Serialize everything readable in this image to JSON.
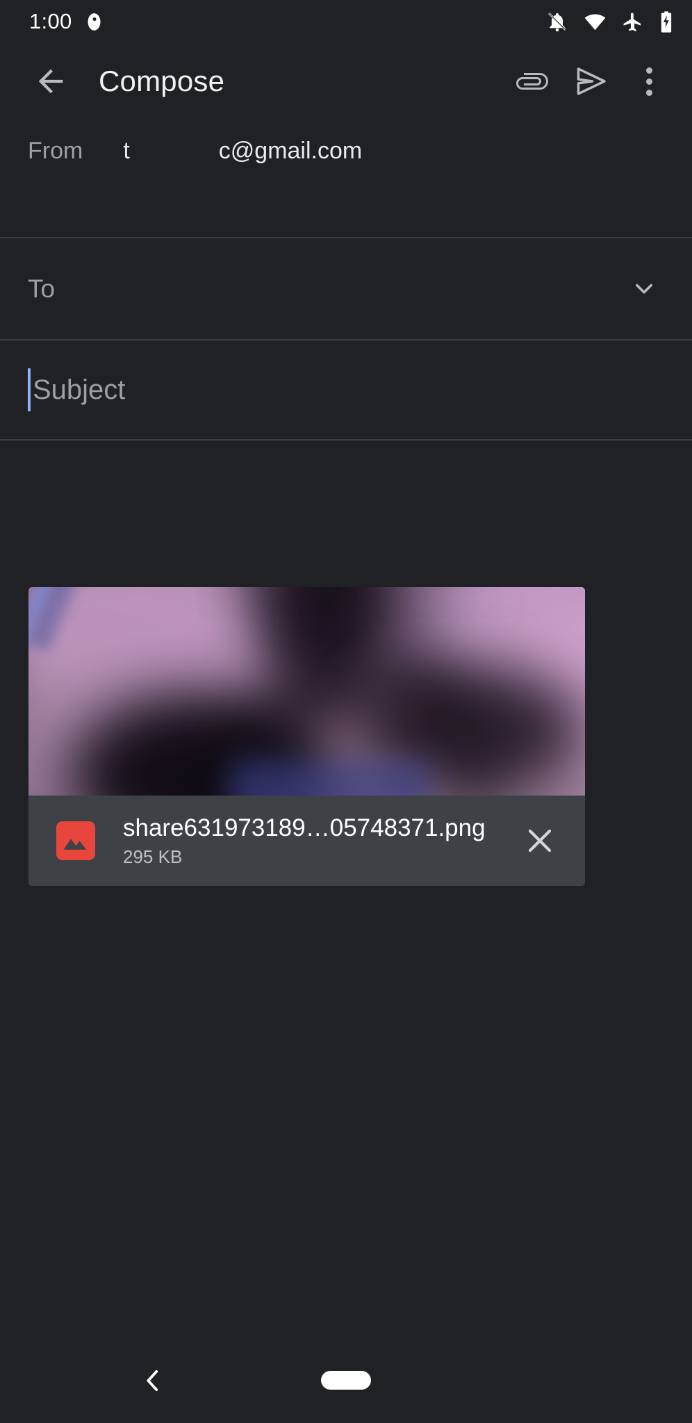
{
  "status_bar": {
    "time": "1:00",
    "icons": [
      "clock-badge-icon",
      "notifications-off-icon",
      "wifi-icon",
      "airplane-mode-icon",
      "battery-charging-icon"
    ]
  },
  "app_bar": {
    "back_label": "",
    "title": "Compose",
    "attach_label": "",
    "send_label": "",
    "more_label": ""
  },
  "compose": {
    "from": {
      "label": "From",
      "value_prefix": "t",
      "value_suffix": "c@gmail.com"
    },
    "to": {
      "placeholder": "To"
    },
    "subject": {
      "placeholder": "Subject",
      "value": ""
    },
    "body": {
      "value": ""
    }
  },
  "attachment": {
    "file_name": "share631973189…05748371.png",
    "file_size": "295 KB",
    "type_icon": "image-file-icon",
    "remove_label": ""
  },
  "nav_bar": {
    "back_label": "",
    "home_label": ""
  },
  "colors": {
    "background": "#1f2125",
    "app_bar_text": "#f0f1f2",
    "hint_text": "#9aa0a6",
    "divider": "#3a3d42",
    "caret_accent": "#8ab4f8",
    "attachment_meta_bg": "#3e4247",
    "file_icon_accent": "#e8453c",
    "icon_grey": "#b6bbc0"
  }
}
